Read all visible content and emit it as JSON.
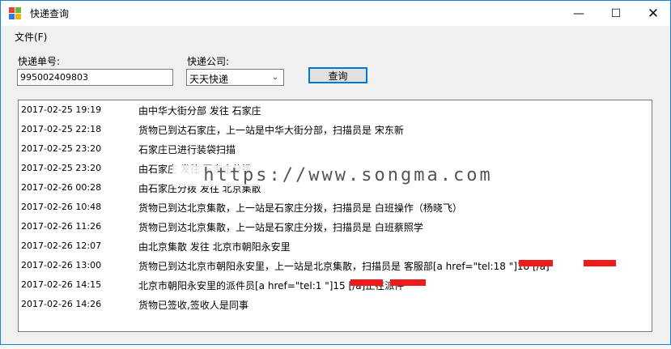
{
  "window": {
    "title": "快递查询",
    "controls": {
      "minimize": "—",
      "maximize": "☐",
      "close": "✕"
    }
  },
  "menu": {
    "file": "文件(F)"
  },
  "form": {
    "tracking_label": "快递单号:",
    "tracking_value": "995002409803",
    "company_label": "快递公司:",
    "company_value": "天天快递",
    "query_button": "查询"
  },
  "records": [
    {
      "time": "2017-02-25 19:19",
      "message": "由中华大街分部 发往 石家庄"
    },
    {
      "time": "2017-02-25 22:18",
      "message": "货物已到达石家庄，上一站是中华大街分部，扫描员是 宋东新"
    },
    {
      "time": "2017-02-25 23:20",
      "message": "石家庄已进行装袋扫描"
    },
    {
      "time": "2017-02-25 23:20",
      "message": "由石家庄 发往 石家庄分拨"
    },
    {
      "time": "2017-02-26 00:28",
      "message": "由石家庄分拨 发往 北京集散"
    },
    {
      "time": "2017-02-26 10:48",
      "message": "货物已到达北京集散，上一站是石家庄分拨，扫描员是 白班操作（杨晓飞）"
    },
    {
      "time": "2017-02-26 11:26",
      "message": "货物已到达北京集散，上一站是石家庄分拨，扫描员是 白班蔡照学"
    },
    {
      "time": "2017-02-26 12:07",
      "message": "由北京集散 发往 北京市朝阳永安里"
    },
    {
      "time": "2017-02-26 13:00",
      "message": "货物已到达北京市朝阳永安里，上一站是北京集散，扫描员是 客服部[a href=\"tel:18       \"]18       [/a]"
    },
    {
      "time": "2017-02-26 14:15",
      "message": "北京市朝阳永安里的派件员[a href=\"tel:1       \"]15       [/a]正在派件"
    },
    {
      "time": "2017-02-26 14:26",
      "message": "货物已签收,签收人是同事"
    }
  ],
  "watermark": "https://www.songma.com",
  "colors": {
    "window_bg": "#f0f0f0",
    "accent": "#0078d7",
    "redaction": "#ee1c1c"
  }
}
